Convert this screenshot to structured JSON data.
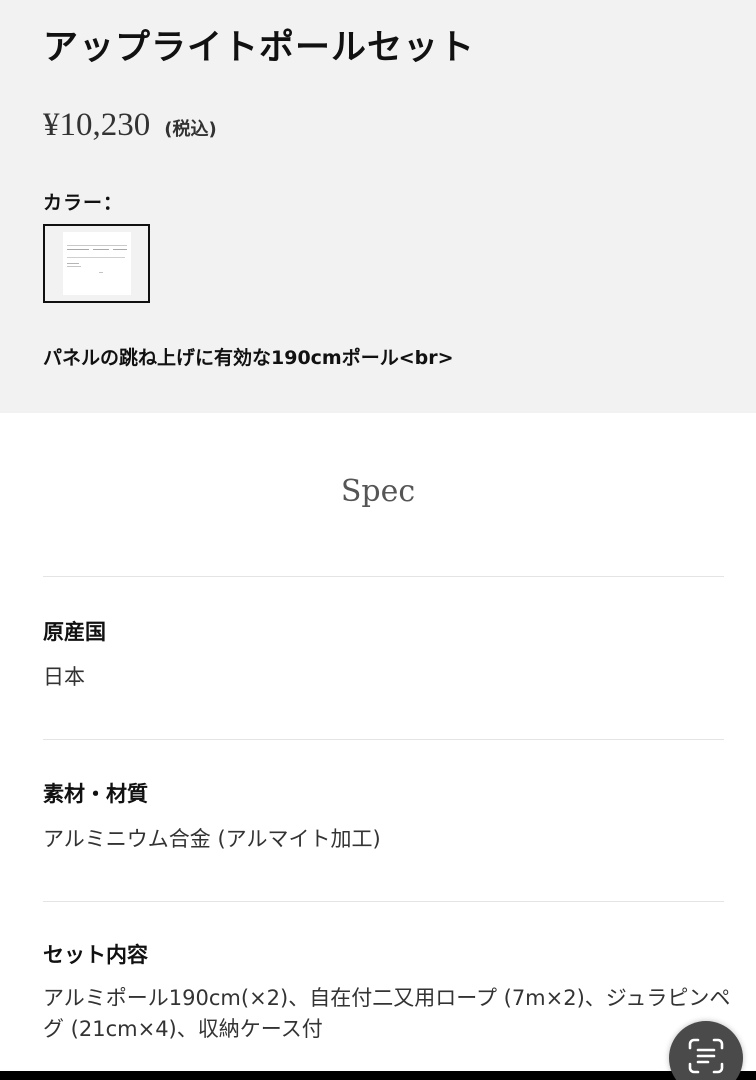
{
  "product": {
    "title": "アップライトポールセット",
    "price": "¥10,230",
    "tax_note": "(税込)",
    "color_label": "カラー：",
    "short_description": "パネルの跳ね上げに有効な190cmポール<br>"
  },
  "spec": {
    "heading": "Spec",
    "rows": [
      {
        "name": "原産国",
        "value": "日本"
      },
      {
        "name": "素材・材質",
        "value": "アルミニウム合金 (アルマイト加工)"
      },
      {
        "name": "セット内容",
        "value": "アルミポール190cm(×2)、自在付二又用ロープ (7m×2)、ジュラピンペグ (21cm×4)、収納ケース付"
      }
    ]
  },
  "overlay": {
    "lens_button_icon": "text-scan-icon"
  },
  "colors": {
    "top_background": "#f2f2f2",
    "page_background": "#ffffff",
    "text": "#111111"
  }
}
